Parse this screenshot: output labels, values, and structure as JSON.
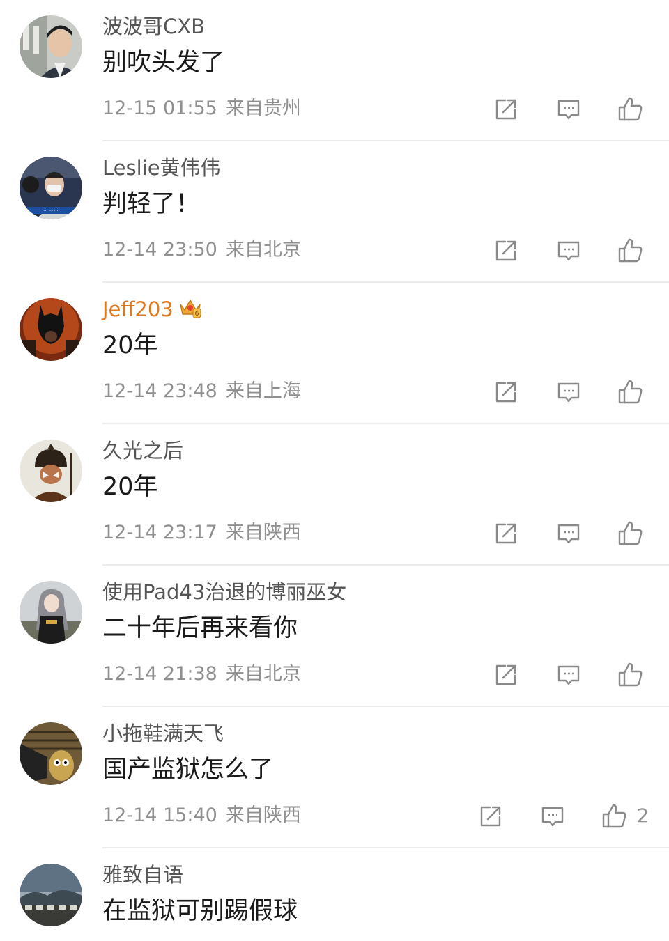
{
  "comments": [
    {
      "username": "波波哥CXB",
      "content": "别吹头发了",
      "time": "12-15 01:55",
      "location": "来自贵州",
      "likes": ""
    },
    {
      "username": "Leslie黄伟伟",
      "content": "判轻了！",
      "time": "12-14 23:50",
      "location": "来自北京",
      "likes": ""
    },
    {
      "username": "Jeff203",
      "content": "20年",
      "time": "12-14 23:48",
      "location": "来自上海",
      "likes": ""
    },
    {
      "username": "久光之后",
      "content": "20年",
      "time": "12-14 23:17",
      "location": "来自陕西",
      "likes": ""
    },
    {
      "username": "使用Pad43治退的博丽巫女",
      "content": "二十年后再来看你",
      "time": "12-14 21:38",
      "location": "来自北京",
      "likes": ""
    },
    {
      "username": "小拖鞋满天飞",
      "content": "国产监狱怎么了",
      "time": "12-14 15:40",
      "location": "来自陕西",
      "likes": "2"
    },
    {
      "username": "雅致自语",
      "content": "在监狱可别踢假球",
      "time": "",
      "location": "",
      "likes": ""
    }
  ],
  "icons": {
    "share": "share-icon",
    "reply": "comment-icon",
    "like": "thumbs-up-icon",
    "vip": "crown-badge-icon"
  },
  "colors": {
    "vip_name": "#e0791e",
    "meta": "#8f8f8f",
    "username": "#555555"
  }
}
